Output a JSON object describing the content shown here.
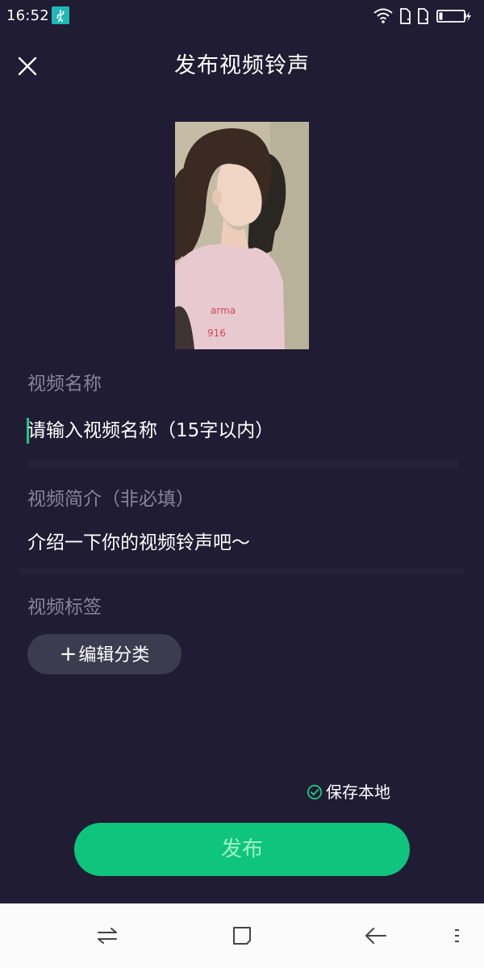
{
  "status_bar": {
    "time": "16:52",
    "icons": [
      "usb-icon",
      "wifi-icon",
      "sim-icon",
      "sim-icon",
      "battery-icon"
    ]
  },
  "header": {
    "title": "发布视频铃声",
    "close_icon": "close-icon"
  },
  "form": {
    "video_name": {
      "label": "视频名称",
      "placeholder": "请输入视频名称（15字以内）"
    },
    "video_intro": {
      "label": "视频简介（非必填）",
      "placeholder": "介绍一下你的视频铃声吧～"
    },
    "video_tags": {
      "label": "视频标签",
      "button_label": "编辑分类",
      "button_icon": "plus-icon"
    }
  },
  "save_local": {
    "label": "保存本地",
    "checked": true,
    "icon": "check-circle-icon"
  },
  "publish": {
    "label": "发布"
  },
  "nav_bar": {
    "icons": [
      "switch-apps-icon",
      "home-icon",
      "back-icon",
      "menu-icon"
    ]
  },
  "colors": {
    "background": "#201c33",
    "accent_green": "#0fc47c",
    "label_gray": "#86839a",
    "tag_button_bg": "#3d3b4f"
  }
}
